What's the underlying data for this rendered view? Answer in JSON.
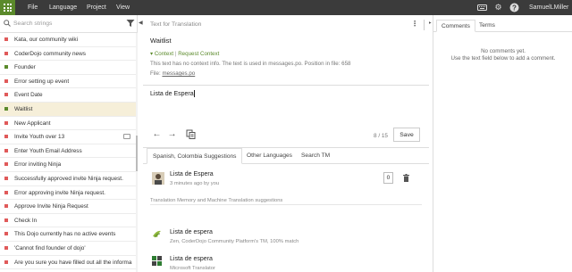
{
  "topbar": {
    "menu": [
      "File",
      "Language",
      "Project",
      "View"
    ],
    "user": "SamuelLMiller",
    "icons": [
      "keyboard-icon",
      "gear-icon",
      "help-icon"
    ],
    "accent": "#5b8a2b",
    "background": "#3b3b3b"
  },
  "sidebar": {
    "search_placeholder": "Search strings",
    "items": [
      {
        "label": "Kata, our community wiki",
        "status": "#e05a5a",
        "selected": false,
        "comment": false
      },
      {
        "label": "CoderDojo community news",
        "status": "#e05a5a",
        "selected": false,
        "comment": false
      },
      {
        "label": "Founder",
        "status": "#5b8a2b",
        "selected": false,
        "comment": false
      },
      {
        "label": "Error setting up event",
        "status": "#e05a5a",
        "selected": false,
        "comment": false
      },
      {
        "label": "Event Date",
        "status": "#e05a5a",
        "selected": false,
        "comment": false
      },
      {
        "label": "Waitlist",
        "status": "#5b8a2b",
        "selected": true,
        "comment": false
      },
      {
        "label": "New Applicant",
        "status": "#e05a5a",
        "selected": false,
        "comment": false
      },
      {
        "label": "Invite Youth over 13",
        "status": "#e05a5a",
        "selected": false,
        "comment": true
      },
      {
        "label": "Enter Youth Email Address",
        "status": "#e05a5a",
        "selected": false,
        "comment": false
      },
      {
        "label": "Error inviting Ninja",
        "status": "#e05a5a",
        "selected": false,
        "comment": false
      },
      {
        "label": "Successfully approved invite Ninja request.",
        "status": "#e05a5a",
        "selected": false,
        "comment": false
      },
      {
        "label": "Error approving invite Ninja request.",
        "status": "#e05a5a",
        "selected": false,
        "comment": false
      },
      {
        "label": "Approve Invite Ninja Request",
        "status": "#e05a5a",
        "selected": false,
        "comment": false
      },
      {
        "label": "Check In",
        "status": "#e05a5a",
        "selected": false,
        "comment": false
      },
      {
        "label": "This Dojo currently has no active events",
        "status": "#e05a5a",
        "selected": false,
        "comment": false
      },
      {
        "label": "'Cannot find founder of dojo'",
        "status": "#e05a5a",
        "selected": false,
        "comment": false
      },
      {
        "label": "Are you sure you have filled out all the informa...",
        "status": "#e05a5a",
        "selected": false,
        "comment": false
      }
    ]
  },
  "editor": {
    "source_header": "Text for Translation",
    "source_text": "Waitlist",
    "context_label": "Context",
    "request_context": "Request Context",
    "context_info": "This text has no context info. The text is used in messages.po. Position in file: 658",
    "file_label": "File:",
    "file_name": "messages.po",
    "translation": "Lista de Espera",
    "counter": "8 / 15",
    "save_label": "Save"
  },
  "suggestions": {
    "tabs": [
      "Spanish, Colombia Suggestions",
      "Other Languages",
      "Search TM"
    ],
    "own": {
      "text": "Lista de Espera",
      "meta": "3 minutes ago by you",
      "votes": "0"
    },
    "tm_header": "Translation Memory and Machine Translation suggestions",
    "tm": [
      {
        "text": "Lista de espera",
        "meta": "Zen, CoderDojo Community Platform's TM, 100% match"
      },
      {
        "text": "Lista de espera",
        "meta": "Microsoft Translator"
      }
    ]
  },
  "comments": {
    "tabs": [
      "Comments",
      "Terms"
    ],
    "empty_line1": "No comments yet.",
    "empty_line2": "Use the text field below to add a comment."
  }
}
